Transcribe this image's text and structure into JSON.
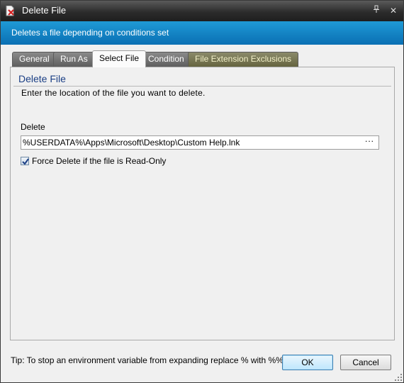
{
  "window": {
    "title": "Delete File",
    "pin_icon": "pin-icon",
    "close_icon": "close-icon"
  },
  "banner": {
    "description": "Deletes a file depending on conditions set"
  },
  "tabs": [
    {
      "label": "General"
    },
    {
      "label": "Run As"
    },
    {
      "label": "Select File",
      "active": true
    },
    {
      "label": "Condition"
    },
    {
      "label": "File Extension Exclusions"
    }
  ],
  "select_file": {
    "section_title": "Delete File",
    "instruction": "Enter the location of the file you want to delete.",
    "delete_label": "Delete",
    "path_value": "%USERDATA%\\Apps\\Microsoft\\Desktop\\Custom Help.lnk",
    "browse_label": "···",
    "force_delete_label": "Force Delete if the file is Read-Only",
    "force_delete_checked": true
  },
  "footer": {
    "tip": "Tip: To stop an environment variable from expanding replace % with %%.",
    "ok_label": "OK",
    "cancel_label": "Cancel"
  },
  "colors": {
    "titlebar": "#2c2c2c",
    "banner": "#1186c8",
    "section_title": "#1b3f85",
    "tab_exclusions": "#6f6e4a"
  }
}
